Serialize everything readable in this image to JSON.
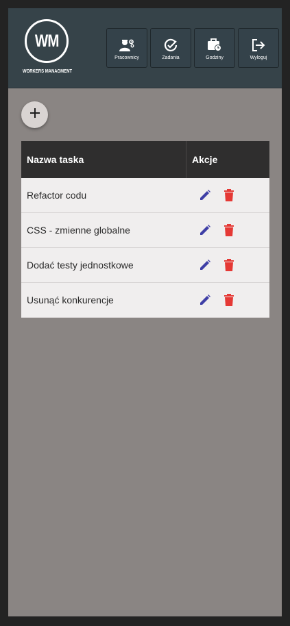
{
  "app": {
    "logo_monogram": "WM",
    "logo_name": "WORKERS MANAGMENT"
  },
  "nav": [
    {
      "label": "Pracownicy",
      "icon": "workers-gear-icon"
    },
    {
      "label": "Zadania",
      "icon": "check-circle-icon"
    },
    {
      "label": "Godziny",
      "icon": "briefcase-clock-icon"
    },
    {
      "label": "Wyloguj",
      "icon": "logout-icon"
    }
  ],
  "add_button": {
    "icon": "plus-icon"
  },
  "table": {
    "columns": [
      "Nazwa taska",
      "Akcje"
    ],
    "rows": [
      {
        "name": "Refactor codu"
      },
      {
        "name": "CSS - zmienne globalne"
      },
      {
        "name": "Dodać testy jednostkowe"
      },
      {
        "name": "Usunąć konkurencje"
      }
    ]
  },
  "colors": {
    "header_bg": "#364349",
    "page_bg": "#8a8583",
    "edit_icon": "#3f3fa6",
    "delete_icon": "#e53935"
  }
}
